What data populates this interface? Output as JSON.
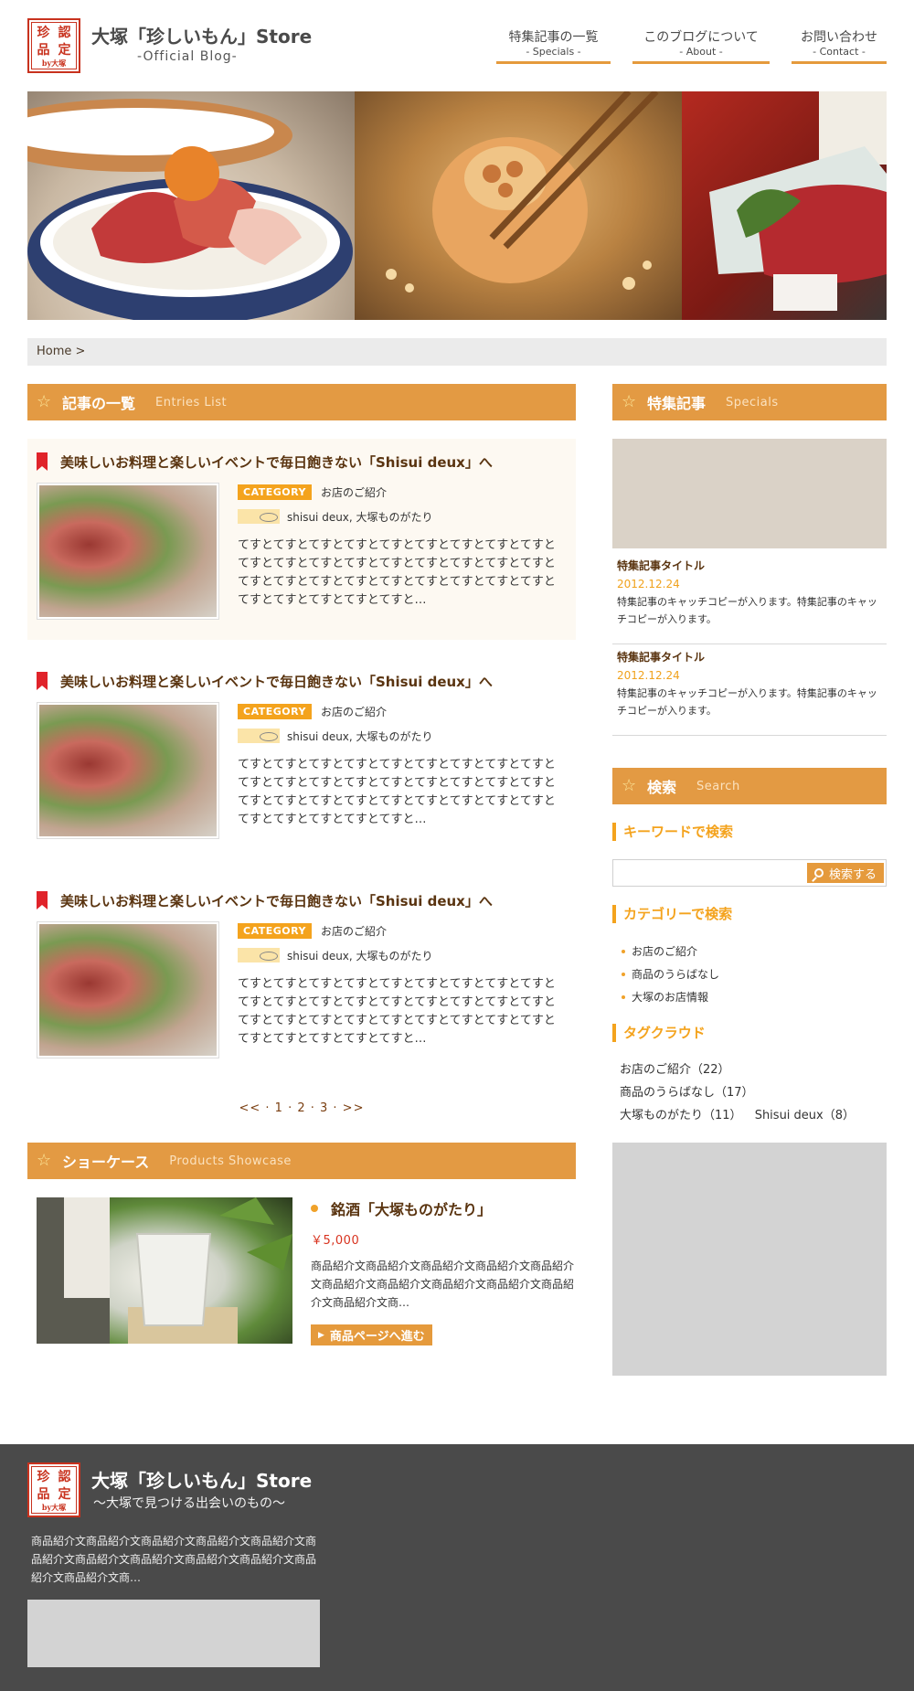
{
  "header": {
    "seal": {
      "c1": "珍",
      "c2": "認",
      "c3": "品",
      "c4": "定",
      "by": "by大塚"
    },
    "title": "大塚「珍しいもん」Store",
    "subtitle": "-Official Blog-",
    "nav": [
      {
        "jp": "特集記事の一覧",
        "en": "- Specials -"
      },
      {
        "jp": "このブログについて",
        "en": "- About -"
      },
      {
        "jp": "お問い合わせ",
        "en": "- Contact -"
      }
    ]
  },
  "breadcrumb": "Home >",
  "entries_section": {
    "jp": "記事の一覧",
    "en": "Entries List"
  },
  "entries": [
    {
      "title": "美味しいお料理と楽しいイベントで毎日飽きない「Shisui deux」へ",
      "category_badge": "CATEGORY",
      "category": "お店のご紹介",
      "tags": "shisui deux, 大塚ものがたり",
      "excerpt": "てすとてすとてすとてすとてすとてすとてすとてすとてすとてすとてすとてすとてすとてすとてすとてすとてすとてすとてすとてすとてすとてすとてすとてすとてすとてすとてすとてすとてすとてすとてすとてすと…"
    },
    {
      "title": "美味しいお料理と楽しいイベントで毎日飽きない「Shisui deux」へ",
      "category_badge": "CATEGORY",
      "category": "お店のご紹介",
      "tags": "shisui deux, 大塚ものがたり",
      "excerpt": "てすとてすとてすとてすとてすとてすとてすとてすとてすとてすとてすとてすとてすとてすとてすとてすとてすとてすとてすとてすとてすとてすとてすとてすとてすとてすとてすとてすとてすとてすとてすとてすと…"
    },
    {
      "title": "美味しいお料理と楽しいイベントで毎日飽きない「Shisui deux」へ",
      "category_badge": "CATEGORY",
      "category": "お店のご紹介",
      "tags": "shisui deux, 大塚ものがたり",
      "excerpt": "てすとてすとてすとてすとてすとてすとてすとてすとてすとてすとてすとてすとてすとてすとてすとてすとてすとてすとてすとてすとてすとてすとてすとてすとてすとてすとてすとてすとてすとてすとてすとてすと…"
    }
  ],
  "pager": "<< · 1 · 2 · 3 · >>",
  "showcase_section": {
    "jp": "ショーケース",
    "en": "Products Showcase"
  },
  "showcase": {
    "name": "銘酒「大塚ものがたり」",
    "price": "￥5,000",
    "desc": "商品紹介文商品紹介文商品紹介文商品紹介文商品紹介文商品紹介文商品紹介文商品紹介文商品紹介文商品紹介文商品紹介文商…",
    "button": "商品ページへ進む"
  },
  "specials_section": {
    "jp": "特集記事",
    "en": "Specials"
  },
  "specials": [
    {
      "title": "特集記事タイトル",
      "date": "2012.12.24",
      "copy": "特集記事のキャッチコピーが入ります。特集記事のキャッチコピーが入ります。"
    },
    {
      "title": "特集記事タイトル",
      "date": "2012.12.24",
      "copy": "特集記事のキャッチコピーが入ります。特集記事のキャッチコピーが入ります。"
    }
  ],
  "search_section": {
    "jp": "検索",
    "en": "Search"
  },
  "search": {
    "keyword_head": "キーワードで検索",
    "input_value": "",
    "button": "検索する",
    "category_head": "カテゴリーで検索",
    "categories": [
      "お店のご紹介",
      "商品のうらばなし",
      "大塚のお店情報"
    ],
    "tag_head": "タグクラウド",
    "tags": [
      "お店のご紹介（22）",
      "商品のうらばなし（17）",
      "大塚ものがたり（11）",
      "Shisui deux（8）"
    ]
  },
  "footer": {
    "title": "大塚「珍しいもん」Store",
    "subtitle": "〜大塚で見つける出会いのもの〜",
    "desc": "商品紹介文商品紹介文商品紹介文商品紹介文商品紹介文商品紹介文商品紹介文商品紹介文商品紹介文商品紹介文商品紹介文商品紹介文商…"
  },
  "colors": {
    "accent": "#e39a43",
    "badge": "#f4a31d",
    "title_brown": "#5a3410",
    "footer_bg": "#4a4a4a",
    "seal_red": "#c8321e"
  }
}
